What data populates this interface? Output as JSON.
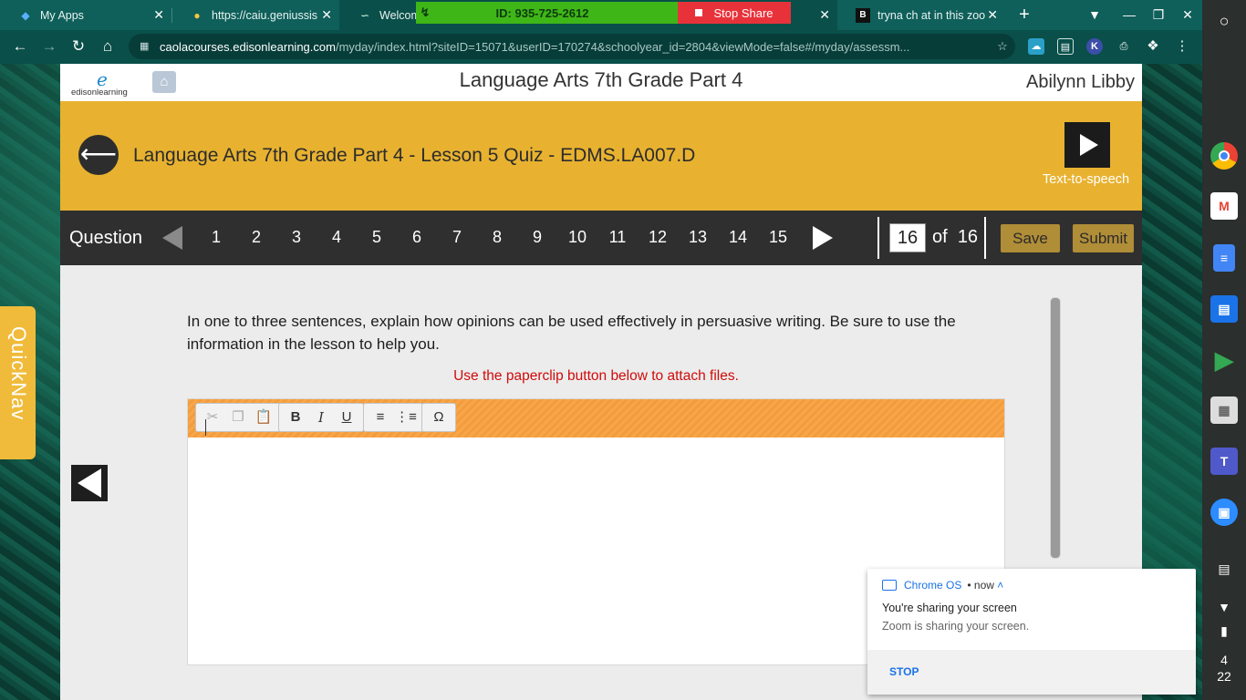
{
  "browser": {
    "tabs": [
      {
        "label": "My Apps",
        "icon": "zoom-icon"
      },
      {
        "label": "https://caiu.geniussis",
        "icon": "lightbulb-icon"
      },
      {
        "label": "Welcome",
        "icon": "edison-icon"
      },
      {
        "label": "tryna ch at in this zoo",
        "icon": "b-icon"
      }
    ],
    "url_host": "caolacourses.edisonlearning.com",
    "url_path": "/myday/index.html?siteID=15071&userID=170274&schoolyear_id=2804&viewMode=false#/myday/assessm..."
  },
  "zoom_bar": {
    "meeting_id": "ID: 935-725-2612",
    "stop_share": "Stop Share"
  },
  "page": {
    "course_title": "Language Arts 7th Grade Part 4",
    "user_name": "Abilynn Libby",
    "logo_text": "edisonlearning",
    "quiz_title": "Language Arts 7th Grade Part 4 - Lesson 5 Quiz - EDMS.LA007.D",
    "tts_label": "Text-to-speech",
    "question_label": "Question",
    "question_numbers": [
      "1",
      "2",
      "3",
      "4",
      "5",
      "6",
      "7",
      "8",
      "9",
      "10",
      "11",
      "12",
      "13",
      "14",
      "15"
    ],
    "current_question": "16",
    "of_label": "of",
    "total_questions": "16",
    "save_label": "Save",
    "submit_label": "Submit",
    "question_text": "In one to three sentences, explain how opinions can be used effectively in persuasive writing. Be sure to use the information in the lesson to help you.",
    "attach_note": "Use the paperclip button below to attach files.",
    "answer_value": "",
    "quicknav_label": "QuickNav"
  },
  "shelf": {
    "clock_hour": "4",
    "clock_min": "22"
  },
  "notification": {
    "source": "Chrome OS",
    "time": "now",
    "title": "You're sharing your screen",
    "body": "Zoom is sharing your screen.",
    "action": "STOP"
  },
  "colors": {
    "banner": "#e8b230",
    "question_bar": "#2f2f2f",
    "note_red": "#d10a0a",
    "zoom_green": "#3fb618",
    "zoom_red": "#e8323a",
    "chrome_teal": "#0a4f4a"
  }
}
